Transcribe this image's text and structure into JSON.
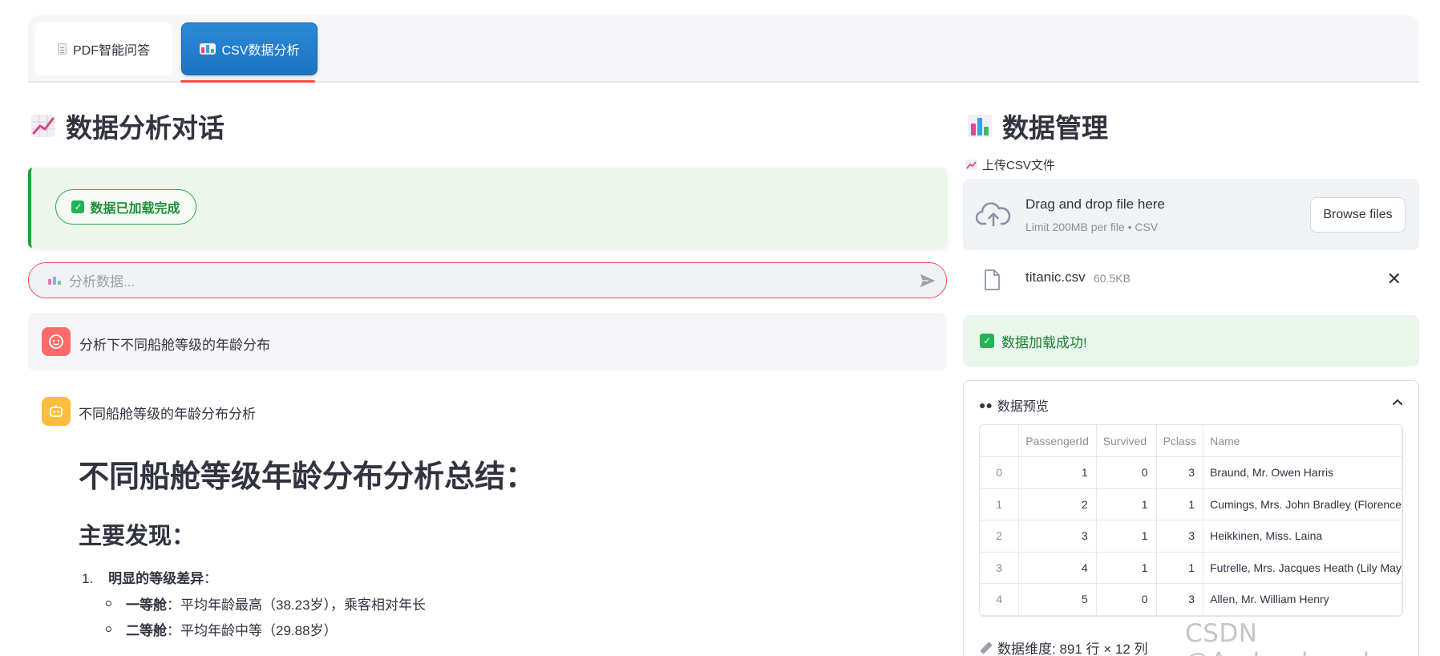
{
  "tabs": [
    {
      "label": "PDF智能问答",
      "icon": "document-icon"
    },
    {
      "label": "CSV数据分析",
      "icon": "bar-chart-icon",
      "active": true
    }
  ],
  "left": {
    "title": "数据分析对话",
    "status_pill": "数据已加载完成",
    "chat_placeholder": "分析数据...",
    "user_message": "分析下不同船舱等级的年龄分布",
    "bot_title": "不同船舱等级的年龄分布分析",
    "md_h1": "不同船舱等级年龄分布分析总结：",
    "md_h2": "主要发现：",
    "md_item1_index": "1.",
    "md_item1_bold": "明显的等级差异",
    "md_item1_rest": "：",
    "md_sub": [
      {
        "bold": "一等舱",
        "text": "：平均年龄最高（38.23岁），乘客相对年长"
      },
      {
        "bold": "二等舱",
        "text": "：平均年龄中等（29.88岁）"
      }
    ]
  },
  "right": {
    "title": "数据管理",
    "upload_label": "上传CSV文件",
    "dropzone_title": "Drag and drop file here",
    "dropzone_sub": "Limit 200MB per file • CSV",
    "browse_label": "Browse files",
    "file_name": "titanic.csv",
    "file_size": "60.5KB",
    "success_text": "数据加载成功!",
    "preview_label": "数据预览",
    "table": {
      "headers": [
        "",
        "PassengerId",
        "Survived",
        "Pclass",
        "Name"
      ],
      "rows": [
        [
          "0",
          "1",
          "0",
          "3",
          "Braund, Mr. Owen Harris"
        ],
        [
          "1",
          "2",
          "1",
          "1",
          "Cumings, Mrs. John Bradley (Florence"
        ],
        [
          "2",
          "3",
          "1",
          "3",
          "Heikkinen, Miss. Laina"
        ],
        [
          "3",
          "4",
          "1",
          "1",
          "Futrelle, Mrs. Jacques Heath (Lily May"
        ],
        [
          "4",
          "5",
          "0",
          "3",
          "Allen, Mr. William Henry"
        ]
      ]
    },
    "dims_text": "数据维度: 891 行 × 12 列"
  },
  "watermark": "CSDN @Andy_shenzl",
  "colors": {
    "accent": "#ff4b4b",
    "tab_active": "#1d73c2",
    "success": "#22a43a"
  }
}
